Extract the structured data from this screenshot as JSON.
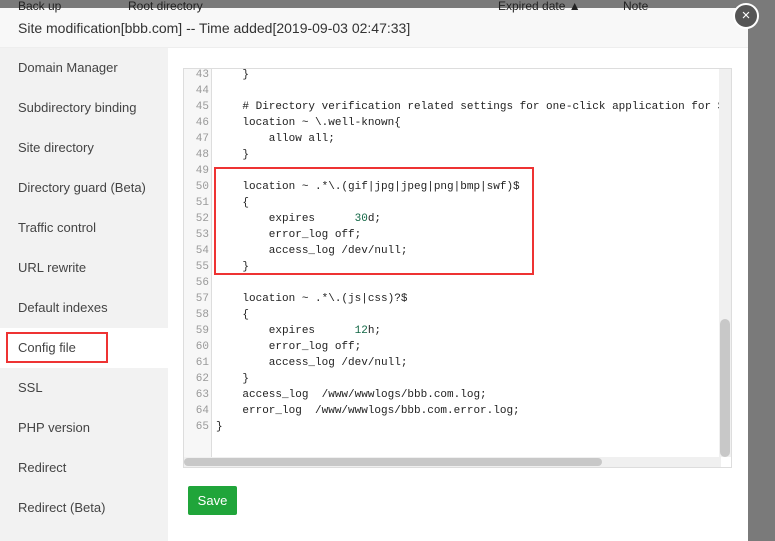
{
  "background_header": [
    "Back up",
    "Root directory",
    "Expired date ▲",
    "Note"
  ],
  "title": "Site modification[bbb.com] -- Time added[2019-09-03 02:47:33]",
  "close_label": "×",
  "sidebar": [
    "Domain Manager",
    "Subdirectory binding",
    "Site directory",
    "Directory guard (Beta)",
    "Traffic control",
    "URL rewrite",
    "Default indexes",
    "Config file",
    "SSL",
    "PHP version",
    "Redirect",
    "Redirect (Beta)"
  ],
  "active_item": "Config file",
  "code": [
    {
      "n": "43",
      "t": "    }"
    },
    {
      "n": "44",
      "t": ""
    },
    {
      "n": "45",
      "t": "    # Directory verification related settings for one-click application for SSL certificate"
    },
    {
      "n": "46",
      "t": "    location ~ \\.well-known{"
    },
    {
      "n": "47",
      "t": "        allow all;"
    },
    {
      "n": "48",
      "t": "    }"
    },
    {
      "n": "49",
      "t": ""
    },
    {
      "n": "50",
      "t": "    location ~ .*\\.(gif|jpg|jpeg|png|bmp|swf)$"
    },
    {
      "n": "51",
      "t": "    {"
    },
    {
      "n": "52",
      "t": "        expires      30d;"
    },
    {
      "n": "53",
      "t": "        error_log off;"
    },
    {
      "n": "54",
      "t": "        access_log /dev/null;"
    },
    {
      "n": "55",
      "t": "    }"
    },
    {
      "n": "56",
      "t": ""
    },
    {
      "n": "57",
      "t": "    location ~ .*\\.(js|css)?$"
    },
    {
      "n": "58",
      "t": "    {"
    },
    {
      "n": "59",
      "t": "        expires      12h;"
    },
    {
      "n": "60",
      "t": "        error_log off;"
    },
    {
      "n": "61",
      "t": "        access_log /dev/null;"
    },
    {
      "n": "62",
      "t": "    }"
    },
    {
      "n": "63",
      "t": "    access_log  /www/wwwlogs/bbb.com.log;"
    },
    {
      "n": "64",
      "t": "    error_log  /www/wwwlogs/bbb.com.error.log;"
    },
    {
      "n": "65",
      "t": "}"
    }
  ],
  "save_label": "Save"
}
